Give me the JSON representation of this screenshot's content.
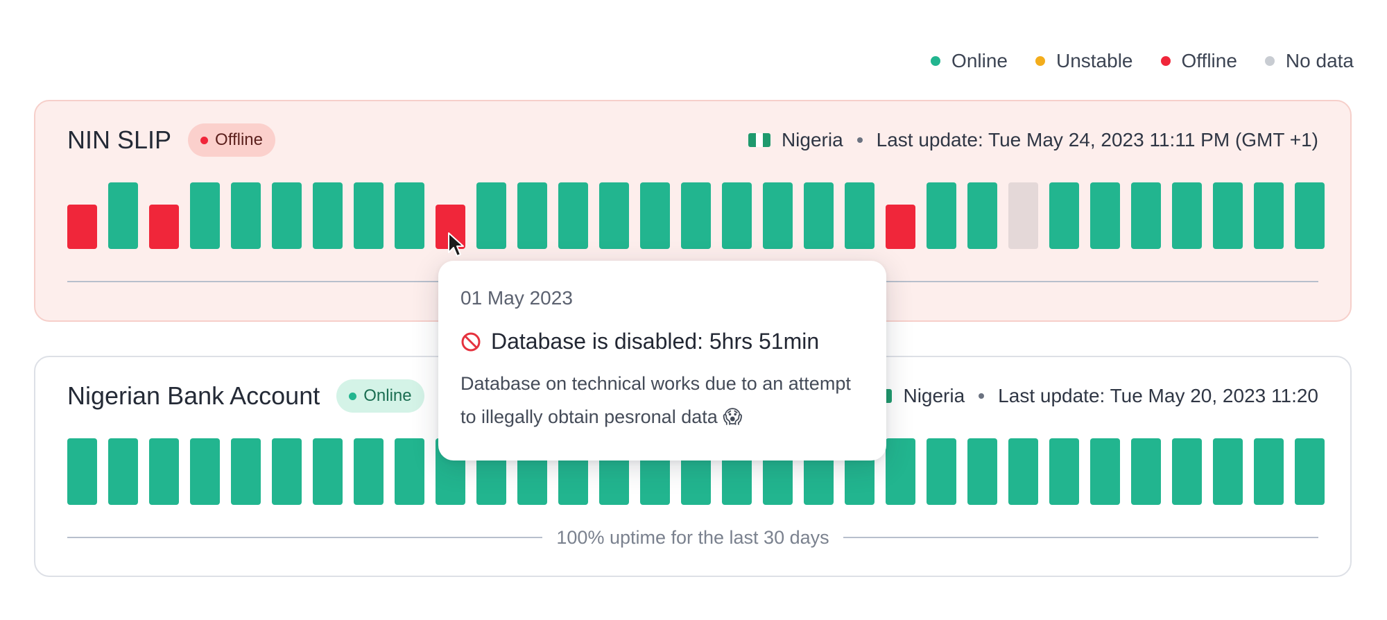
{
  "legend": [
    {
      "label": "Online",
      "color": "#22b58f"
    },
    {
      "label": "Unstable",
      "color": "#f3ad1c"
    },
    {
      "label": "Offline",
      "color": "#f0263a"
    },
    {
      "label": "No data",
      "color": "#c8ccd2"
    }
  ],
  "colors": {
    "online": "#22b58f",
    "unstable": "#f3ad1c",
    "offline": "#f0263a",
    "nodata": "#e4d8d8"
  },
  "services": [
    {
      "name": "NIN SLIP",
      "status": "Offline",
      "status_color": "#f0263a",
      "country": "Nigeria",
      "flag_icon": "nigeria-flag-icon",
      "last_update": "Last update: Tue May 24, 2023 11:11 PM (GMT +1)",
      "days": [
        "offline",
        "online",
        "offline",
        "online",
        "online",
        "online",
        "online",
        "online",
        "online",
        "offline",
        "online",
        "online",
        "online",
        "online",
        "online",
        "online",
        "online",
        "online",
        "online",
        "online",
        "offline",
        "online",
        "online",
        "nodata",
        "online",
        "online",
        "online",
        "online",
        "online",
        "online",
        "online"
      ],
      "uptime_text": ""
    },
    {
      "name": "Nigerian Bank Account",
      "status": "Online",
      "status_color": "#22b58f",
      "country": "Nigeria",
      "flag_icon": "nigeria-flag-icon",
      "last_update": "Last update: Tue May 20, 2023 11:20",
      "days": [
        "online",
        "online",
        "online",
        "online",
        "online",
        "online",
        "online",
        "online",
        "online",
        "online",
        "online",
        "online",
        "online",
        "online",
        "online",
        "online",
        "online",
        "online",
        "online",
        "online",
        "online",
        "online",
        "online",
        "online",
        "online",
        "online",
        "online",
        "online",
        "online",
        "online",
        "online"
      ],
      "uptime_text": "100% uptime for the last 30 days"
    }
  ],
  "tooltip": {
    "date": "01 May 2023",
    "icon": "prohibited-icon",
    "title": "Database is disabled: 5hrs 51min",
    "description": "Database on technical works due to an attempt to illegally obtain pesronal data 😱"
  }
}
